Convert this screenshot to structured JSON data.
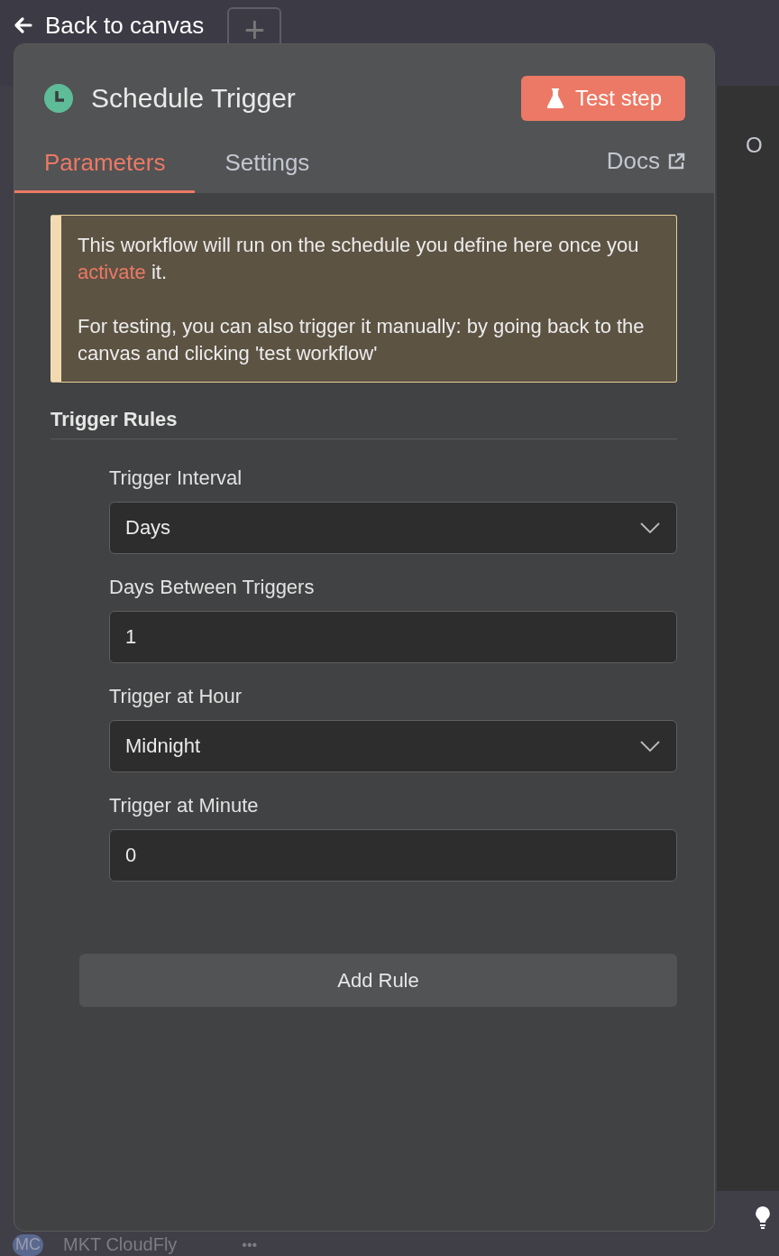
{
  "back_link": {
    "label": "Back to canvas"
  },
  "canvas": {
    "add_button": "+",
    "output_label": "O",
    "workspace": {
      "avatar": "MC",
      "name": "MKT CloudFly",
      "more": "•••"
    }
  },
  "node": {
    "title": "Schedule Trigger",
    "test_button": "Test step",
    "tabs": [
      {
        "label": "Parameters",
        "selected": true
      },
      {
        "label": "Settings",
        "selected": false
      }
    ],
    "docs_link": "Docs",
    "notice": {
      "before": "This workflow will run on the schedule you define here once you ",
      "link": "activate",
      "after": " it.",
      "second": "For testing, you can also trigger it manually: by going back to the canvas and clicking 'test workflow'"
    },
    "section_title": "Trigger Rules",
    "fields": [
      {
        "label": "Trigger Interval",
        "kind": "select",
        "value": "Days"
      },
      {
        "label": "Days Between Triggers",
        "kind": "number",
        "value": "1"
      },
      {
        "label": "Trigger at Hour",
        "kind": "select",
        "value": "Midnight"
      },
      {
        "label": "Trigger at Minute",
        "kind": "number",
        "value": "0"
      }
    ],
    "add_button": "Add Rule"
  }
}
